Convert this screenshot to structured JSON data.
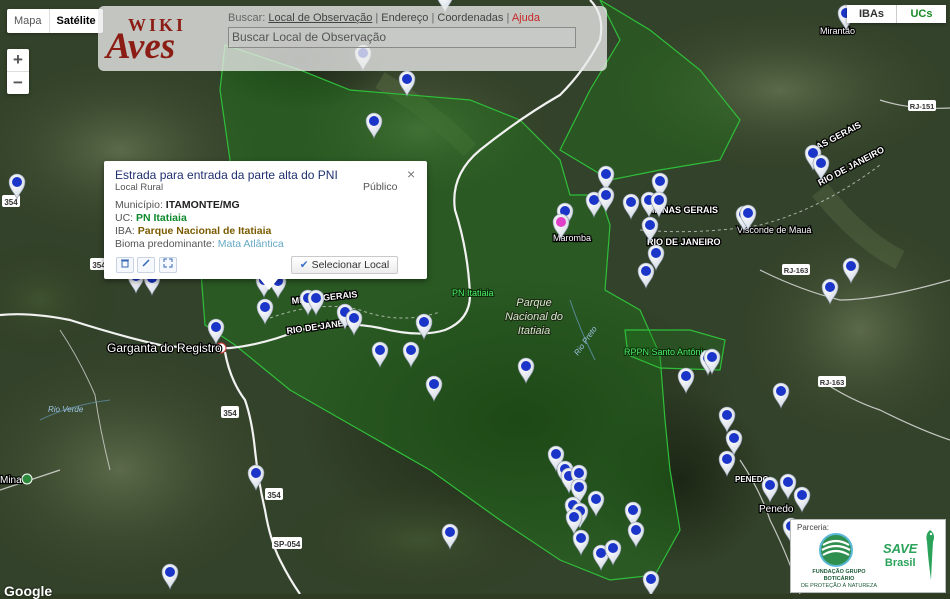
{
  "map_type": {
    "map_label": "Mapa",
    "satellite_label": "Satélite",
    "selected": "Satélite"
  },
  "zoom": {
    "in_label": "+",
    "out_label": "−"
  },
  "search_panel": {
    "logo_top": "WIKI",
    "logo_bottom": "Aves",
    "buscar_label": "Buscar:",
    "option_local": "Local de Observação",
    "option_endereco": "Endereço",
    "option_coordenadas": "Coordenadas",
    "option_ajuda": "Ajuda",
    "separator": "|",
    "search_placeholder": "Buscar Local de Observação"
  },
  "layer_toggles": {
    "iba_label": "IBAs",
    "uc_label": "UCs",
    "uc_color": "#1a8a27"
  },
  "info_window": {
    "title": "Estrada para entrada da parte alta do PNI",
    "type": "Local Rural",
    "access": "Público",
    "municipio_label": "Município:",
    "municipio_value": "ITAMONTE/MG",
    "uc_label": "UC:",
    "uc_value": "PN Itatiaia",
    "iba_label": "IBA:",
    "iba_value": "Parque Nacional de Itatiaia",
    "bioma_label": "Bioma predominante:",
    "bioma_value": "Mata Atlântica",
    "select_button": "Selecionar Local",
    "close_icon": "×",
    "icons": [
      "trash-icon",
      "edit-icon",
      "expand-icon"
    ]
  },
  "map_labels": {
    "garganta": "Garganta do Registro",
    "minas_gerais_1": "MINAS GERAIS",
    "rio_de_janeiro_1": "RIO DE JANEIRO",
    "pn_itatiaia": "PN Itatiaia",
    "parque_line1": "Parque",
    "parque_line2": "Nacional do",
    "parque_line3": "Itatiaia",
    "maromba": "Maromba",
    "minas_gerais_2": "MINAS GERAIS",
    "rio_de_janeiro_2": "RIO DE JANEIRO",
    "visconde_maua": "Visconde de Mauá",
    "as_gerais": "AS GERAIS",
    "rio_de_janeiro_3": "RIO DE JANEIRO",
    "rppn": "RPPN Santo Antônio",
    "rio_preto": "Rio Preto",
    "rio_verde": "Rio Verde",
    "penedo_upper": "PENEDO",
    "penedo": "Penedo",
    "mirantao": "Mirantão",
    "mina": "Mina",
    "road_354_a": "354",
    "road_354_b": "354",
    "road_354_c": "354",
    "road_354_d": "354",
    "road_sp054": "SP-054",
    "road_rj163_a": "RJ-163",
    "road_rj163_b": "RJ-163",
    "road_rj151": "RJ-151",
    "google": "Google"
  },
  "partner": {
    "label": "Parceria:",
    "fgb_line1": "FUNDAÇÃO GRUPO BOTICÁRIO",
    "fgb_line2": "DE PROTEÇÃO À NATUREZA",
    "save_line1": "SAVE",
    "save_line2": "Brasil"
  },
  "colors": {
    "uc_border": "#2fbf3a",
    "pin_blue": "#1b35c9",
    "pin_pink": "#e040c8"
  }
}
